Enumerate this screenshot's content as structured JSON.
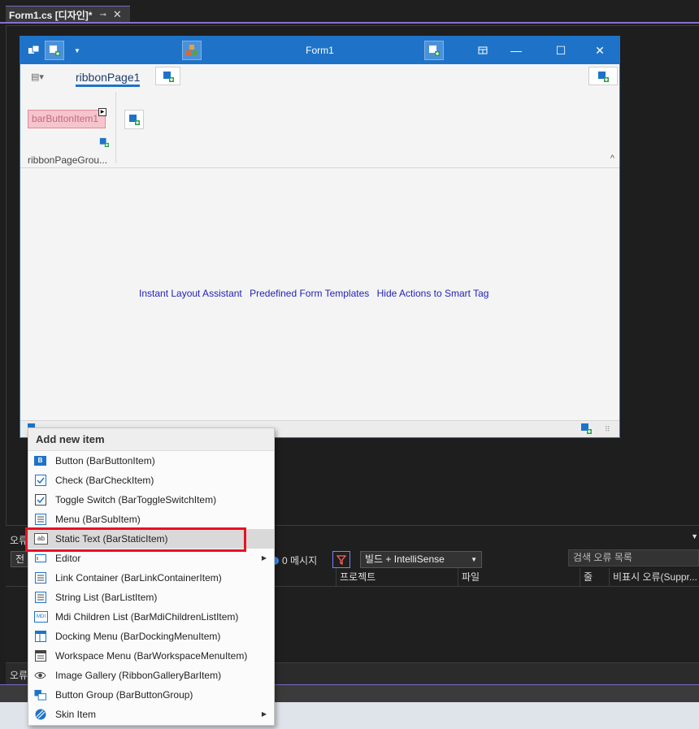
{
  "doc_tab": {
    "title": "Form1.cs [디자인]*",
    "pin_glyph": "⊸",
    "close_glyph": "✕"
  },
  "form": {
    "title": "Form1",
    "window_controls": {
      "minimize": "—",
      "restore": "⧉",
      "maximize": "☐",
      "close": "✕"
    },
    "ribbon": {
      "page_tab": "ribbonPage1",
      "bar_button_item": "barButtonItem1",
      "group_label": "ribbonPageGrou...",
      "collapse": "^"
    },
    "smart_links": [
      "Instant Layout Assistant",
      "Predefined Form Templates",
      "Hide Actions to Smart Tag"
    ]
  },
  "error_panel": {
    "title": "오류",
    "scope_value": "전",
    "message_count": "0 메시지",
    "build_filter": "빌드 + IntelliSense",
    "search_placeholder": "검색 오류 목록",
    "columns": [
      "프로젝트",
      "파일",
      "줄",
      "비표시 오류(Suppr..."
    ],
    "bottom_tab": "오류"
  },
  "context_menu": {
    "header": "Add new item",
    "items": [
      {
        "label": "Button (BarButtonItem)",
        "icon": "button-b-icon",
        "submenu": false
      },
      {
        "label": "Check (BarCheckItem)",
        "icon": "checkbox-icon",
        "submenu": false
      },
      {
        "label": "Toggle Switch (BarToggleSwitchItem)",
        "icon": "toggle-check-icon",
        "submenu": false
      },
      {
        "label": "Menu (BarSubItem)",
        "icon": "menu-icon",
        "submenu": false
      },
      {
        "label": "Static Text (BarStaticItem)",
        "icon": "static-text-ab-icon",
        "submenu": false
      },
      {
        "label": "Editor",
        "icon": "editor-icon",
        "submenu": true
      },
      {
        "label": "Link Container (BarLinkContainerItem)",
        "icon": "link-container-icon",
        "submenu": false
      },
      {
        "label": "String List (BarListItem)",
        "icon": "string-list-icon",
        "submenu": false
      },
      {
        "label": "Mdi Children List (BarMdiChildrenListItem)",
        "icon": "mdi-icon",
        "submenu": false
      },
      {
        "label": "Docking Menu (BarDockingMenuItem)",
        "icon": "docking-menu-icon",
        "submenu": false
      },
      {
        "label": "Workspace Menu (BarWorkspaceMenuItem)",
        "icon": "workspace-menu-icon",
        "submenu": false
      },
      {
        "label": "Image Gallery (RibbonGalleryBarItem)",
        "icon": "eye-icon",
        "submenu": false
      },
      {
        "label": "Button Group (BarButtonGroup)",
        "icon": "button-group-icon",
        "submenu": false
      },
      {
        "label": "Skin Item",
        "icon": "skin-icon",
        "submenu": true
      }
    ],
    "hovered_item": "Static Text (BarStaticItem)",
    "mdi_icon_text": "MDI",
    "ab_icon_text": "ab",
    "b_icon_text": "B",
    "submenu_glyph": "▶"
  },
  "colors": {
    "form_titlebar": "#1e73c8",
    "highlight_box": "#e81123",
    "accent_purple": "#7b68c4",
    "link_blue": "#2323b8"
  }
}
